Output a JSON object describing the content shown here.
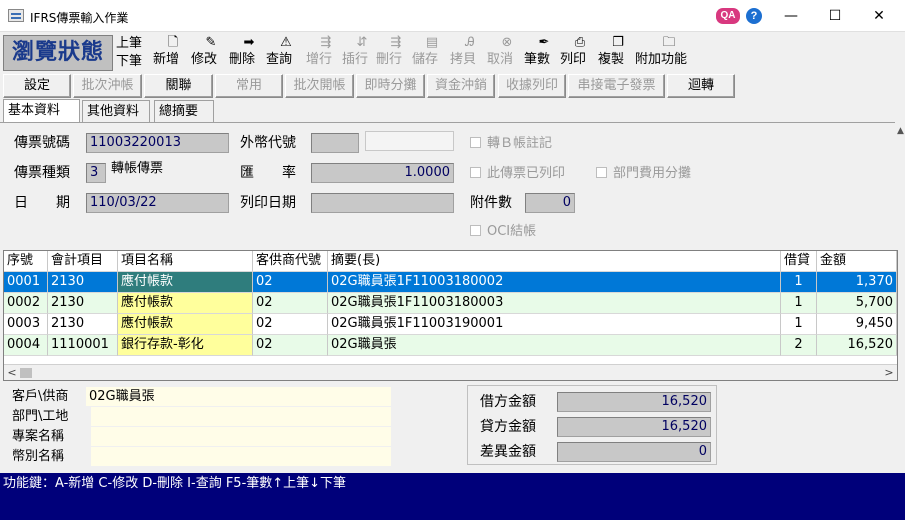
{
  "window": {
    "title": "IFRS傳票輸入作業",
    "qa_label": "QA",
    "help_label": "?",
    "minimize": "—",
    "maximize": "☐",
    "close": "✕"
  },
  "toolbar": {
    "mode": "瀏覽狀態",
    "prev": "上筆",
    "next": "下筆",
    "buttons": [
      {
        "label": "新增",
        "icon": "new-doc-icon",
        "glyph": "🗋",
        "disabled": false
      },
      {
        "label": "修改",
        "icon": "edit-icon",
        "glyph": "✎",
        "disabled": false
      },
      {
        "label": "刪除",
        "icon": "delete-icon",
        "glyph": "➡",
        "disabled": false
      },
      {
        "label": "查詢",
        "icon": "search-icon",
        "glyph": "⚠",
        "disabled": false
      },
      {
        "label": "增行",
        "icon": "insert-row-icon",
        "glyph": "⇶",
        "disabled": true
      },
      {
        "label": "插行",
        "icon": "insert-line-icon",
        "glyph": "⇵",
        "disabled": true
      },
      {
        "label": "刪行",
        "icon": "delete-row-icon",
        "glyph": "⇶",
        "disabled": true
      },
      {
        "label": "儲存",
        "icon": "save-icon",
        "glyph": "▤",
        "disabled": true
      },
      {
        "label": "拷貝",
        "icon": "copy-icon",
        "glyph": "Ꭿ",
        "disabled": true
      },
      {
        "label": "取消",
        "icon": "cancel-icon",
        "glyph": "⊗",
        "disabled": true
      },
      {
        "label": "筆數",
        "icon": "pen-icon",
        "glyph": "✒",
        "disabled": false
      },
      {
        "label": "列印",
        "icon": "print-icon",
        "glyph": "⎙",
        "disabled": false
      },
      {
        "label": "複製",
        "icon": "duplicate-icon",
        "glyph": "❐",
        "disabled": false
      },
      {
        "label": "附加功能",
        "icon": "folder-icon",
        "glyph": "🗀",
        "disabled": false
      }
    ]
  },
  "function_buttons": [
    {
      "label": "設定",
      "disabled": false
    },
    {
      "label": "批次沖帳",
      "disabled": true
    },
    {
      "label": "關聯",
      "disabled": false
    },
    {
      "label": "常用",
      "disabled": true
    },
    {
      "label": "批次開帳",
      "disabled": true
    },
    {
      "label": "即時分攤",
      "disabled": true
    },
    {
      "label": "資金沖銷",
      "disabled": true
    },
    {
      "label": "收據列印",
      "disabled": true
    },
    {
      "label": "串接電子發票",
      "disabled": true
    },
    {
      "label": "迴轉",
      "disabled": false
    }
  ],
  "tabs": [
    "基本資料",
    "其他資料",
    "總摘要"
  ],
  "form": {
    "voucher_no_label": "傳票號碼",
    "voucher_no": "11003220013",
    "voucher_type_label": "傳票種類",
    "voucher_type_code": "3",
    "voucher_type_name": "轉帳傳票",
    "date_label": "日　　期",
    "date": "110/03/22",
    "currency_label": "外幣代號",
    "currency": "",
    "currency_name": "",
    "rate_label": "匯　　率",
    "rate": "1.0000",
    "print_date_label": "列印日期",
    "print_date": "",
    "attach_label": "附件數",
    "attach": "0",
    "chk_b_note": "轉Ｂ帳註記",
    "chk_printed": "此傳票已列印",
    "chk_dept_share": "部門費用分攤",
    "chk_oci": "OCI結帳"
  },
  "grid": {
    "headers": [
      "序號",
      "會計項目",
      "項目名稱",
      "客供商代號",
      "摘要(長)",
      "借貸",
      "金額"
    ],
    "rows": [
      {
        "seq": "0001",
        "acct": "2130",
        "name": "應付帳款",
        "vendor": "02",
        "memo": "02G職員張1F11003180002",
        "dc": "1",
        "amount": "1,370"
      },
      {
        "seq": "0002",
        "acct": "2130",
        "name": "應付帳款",
        "vendor": "02",
        "memo": "02G職員張1F11003180003",
        "dc": "1",
        "amount": "5,700"
      },
      {
        "seq": "0003",
        "acct": "2130",
        "name": "應付帳款",
        "vendor": "02",
        "memo": "02G職員張1F11003190001",
        "dc": "1",
        "amount": "9,450"
      },
      {
        "seq": "0004",
        "acct": "1110001",
        "name": "銀行存款-彰化",
        "vendor": "02",
        "memo": "02G職員張",
        "dc": "2",
        "amount": "16,520"
      }
    ]
  },
  "bottom": {
    "customer_label": "客戶\\供商",
    "customer": "02G職員張",
    "dept_label": "部門\\工地",
    "dept": "",
    "project_label": "專案名稱",
    "project": "",
    "currency_label": "幣別名稱",
    "currency": "",
    "debit_label": "借方金額",
    "debit": "16,520",
    "credit_label": "貸方金額",
    "credit": "16,520",
    "diff_label": "差異金額",
    "diff": "0"
  },
  "status": {
    "text": "功能鍵：A-新增 C-修改 D-刪除 I-查詢 F5-筆數↑上筆↓下筆"
  }
}
